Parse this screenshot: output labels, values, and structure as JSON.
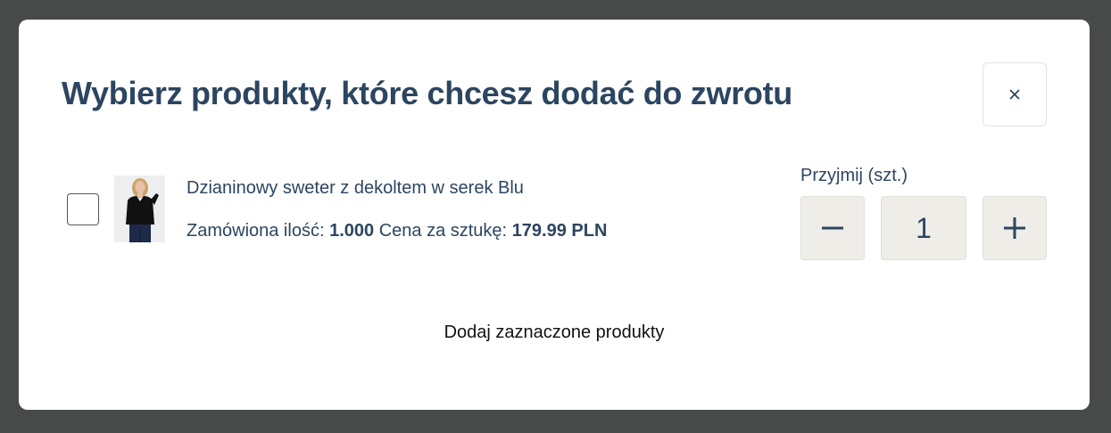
{
  "modal": {
    "title": "Wybierz produkty, które chcesz dodać do zwrotu",
    "close_label": "×"
  },
  "product": {
    "name": "Dzianinowy sweter z dekoltem w serek Blu",
    "ordered_label": "Zamówiona ilość:",
    "ordered_value": "1.000",
    "price_label": "Cena za sztukę:",
    "price_value": "179.99 PLN",
    "checked": false
  },
  "quantity": {
    "label": "Przyjmij (szt.)",
    "value": "1",
    "minus_icon": "minus-icon",
    "plus_icon": "plus-icon"
  },
  "actions": {
    "submit_label": "Dodaj zaznaczone produkty"
  },
  "colors": {
    "overlay": "#484a4a",
    "text_primary": "#2c4560",
    "stepper_bg": "#eeede8"
  }
}
